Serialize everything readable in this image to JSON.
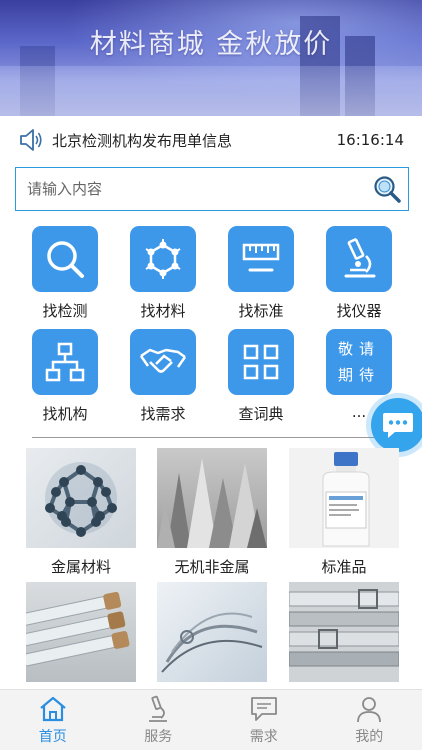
{
  "banner": {
    "title": "材料商城  金秋放价"
  },
  "notice": {
    "text": "北京检测机构发布甩单信息",
    "time": "16:16:14"
  },
  "search": {
    "placeholder": "请输入内容"
  },
  "categories": [
    {
      "label": "找检测",
      "icon": "search-icon"
    },
    {
      "label": "找材料",
      "icon": "molecule-icon"
    },
    {
      "label": "找标准",
      "icon": "ruler-icon"
    },
    {
      "label": "找仪器",
      "icon": "microscope-icon"
    },
    {
      "label": "找机构",
      "icon": "org-chart-icon"
    },
    {
      "label": "找需求",
      "icon": "handshake-icon"
    },
    {
      "label": "查词典",
      "icon": "grid-icon"
    },
    {
      "label": "...",
      "tile_text_1": "敬请",
      "tile_text_2": "期待"
    }
  ],
  "products": [
    {
      "label": "金属材料"
    },
    {
      "label": "无机非金属"
    },
    {
      "label": "标准品"
    },
    {
      "label": ""
    },
    {
      "label": ""
    },
    {
      "label": ""
    }
  ],
  "tabs": [
    {
      "label": "首页",
      "icon": "home-icon",
      "active": true
    },
    {
      "label": "服务",
      "icon": "microscope-icon"
    },
    {
      "label": "需求",
      "icon": "message-icon"
    },
    {
      "label": "我的",
      "icon": "user-icon"
    }
  ],
  "colors": {
    "accent": "#3e98ea",
    "tab_active": "#2a8fe0",
    "search_border": "#2a9be0"
  }
}
